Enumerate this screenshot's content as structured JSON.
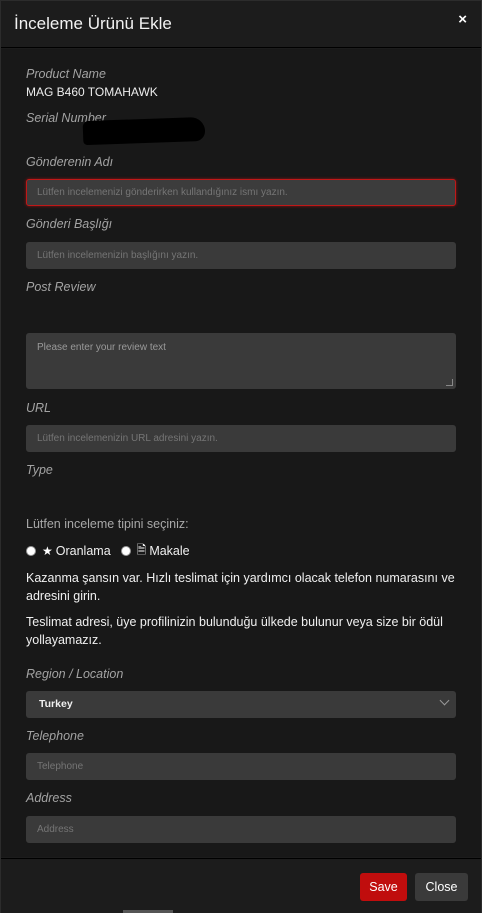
{
  "modal": {
    "title": "İnceleme Ürünü Ekle",
    "close_icon": "×"
  },
  "form": {
    "product_name_label": "Product Name",
    "product_name_value": "MAG B460 TOMAHAWK",
    "serial_number_label": "Serial Number",
    "sender_name_label": "Gönderenin Adı",
    "sender_name_placeholder": "Lütfen incelemenizi gönderirken kullandığınız ismı yazın.",
    "post_title_label": "Gönderi Başlığı",
    "post_title_placeholder": "Lütfen incelemenizin başlığını yazın.",
    "post_review_label": "Post Review",
    "review_text_placeholder": "Please enter your review text",
    "url_label": "URL",
    "url_placeholder": "Lütfen incelemenizin URL adresini yazın.",
    "type_label": "Type",
    "type_prompt": "Lütfen inceleme tipini seçiniz:",
    "type_options": [
      {
        "label": "Oranlama",
        "icon": "star-icon"
      },
      {
        "label": "Makale",
        "icon": "document-icon"
      }
    ],
    "info_text_1": "Kazanma şansın var. Hızlı teslimat için yardımcı olacak telefon numarasını ve adresini girin.",
    "info_text_2": "Teslimat adresi, üye profilinizin bulunduğu ülkede bulunur veya size bir ödül yollayamazız.",
    "region_label": "Region / Location",
    "region_selected": "Turkey",
    "telephone_label": "Telephone",
    "telephone_placeholder": "Telephone",
    "address_label": "Address",
    "address_placeholder": "Address"
  },
  "footer": {
    "save_label": "Save",
    "close_label": "Close"
  },
  "colors": {
    "accent": "#c00d0d",
    "field_bg": "#3a3a3a",
    "background": "#181818"
  }
}
